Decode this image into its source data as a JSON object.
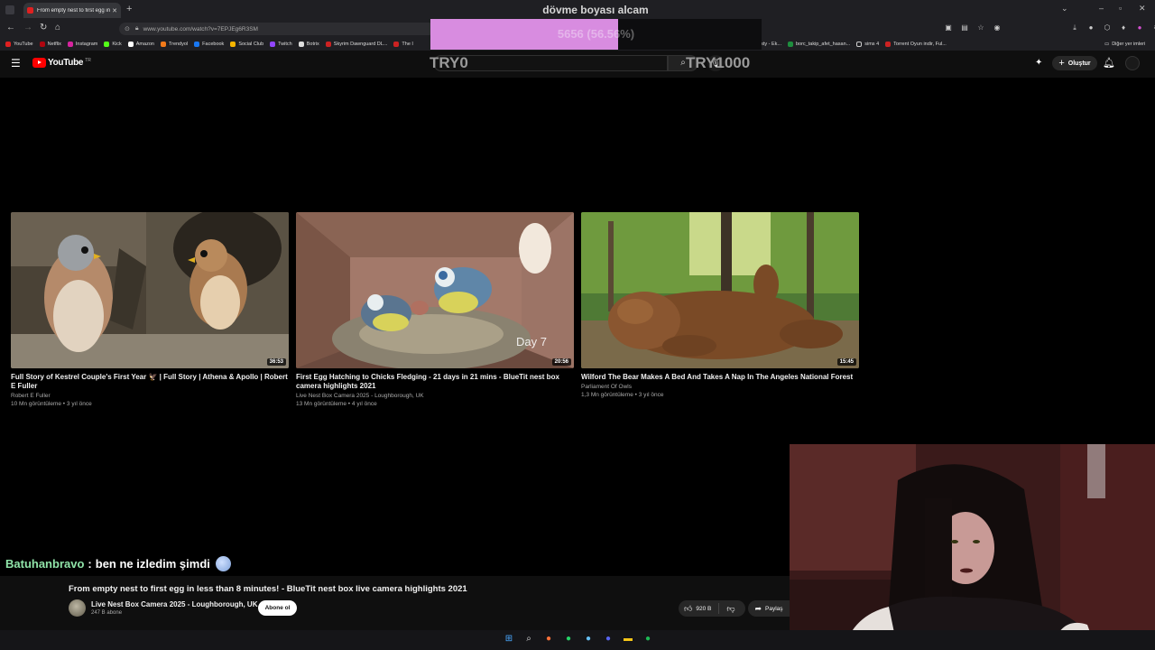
{
  "browser": {
    "tab_title": "From empty nest to first egg in",
    "url": "www.youtube.com/watch?v=7EPJEg6R3SM",
    "bookmarks": [
      "YouTube",
      "Netflix",
      "Instagram",
      "Kick",
      "Amazon",
      "Trendyol",
      "Facebook",
      "Social Club",
      "Twitch",
      "Botrix",
      "Skyrim Dawnguard DL...",
      "The I"
    ],
    "bookmarks_right": [
      "asty - Ek...",
      "borc_takip_afet_hasan...",
      "sims 4",
      "Torrent Oyun indir, Ful..."
    ],
    "other_bookmarks": "Diğer yer imleri"
  },
  "overlay": {
    "title": "dövme boyası alcam",
    "goal_text": "5656 (56.56%)",
    "goal_progress": 0.5656,
    "goal_min": "TRY0",
    "goal_max": "TRY1000",
    "colors": {
      "fill": "#d88ce0"
    }
  },
  "youtube": {
    "logo": "YouTube",
    "logo_region": "TR",
    "create_label": "Oluştur",
    "icons": [
      "menu-icon",
      "search-icon",
      "mic-icon",
      "cast-icon",
      "bell-icon"
    ]
  },
  "videos": [
    {
      "title": "Full Story of Kestrel Couple's First Year 🦅 | Full Story | Athena & Apollo | Robert E Fuller",
      "channel": "Robert E Fuller",
      "meta": "10 Mn görüntüleme • 3 yıl önce",
      "duration": "36:53"
    },
    {
      "title": "First Egg Hatching to Chicks Fledging - 21 days in 21 mins - BlueTit nest box camera highlights 2021",
      "channel": "Live Nest Box Camera 2025 - Loughborough, UK",
      "meta": "13 Mn görüntüleme • 4 yıl önce",
      "duration": "20:56",
      "overlay_text": "Day 7"
    },
    {
      "title": "Wilford The Bear Makes A Bed And Takes A Nap In The Angeles National Forest",
      "channel": "Parliament Of Owls",
      "meta": "1,3 Mn görüntüleme • 3 yıl önce",
      "duration": "15:45"
    }
  ],
  "chat": {
    "user": "Batuhanbravo",
    "separator": ":",
    "message": "ben ne izledim şimdi"
  },
  "player": {
    "title": "From empty nest to first egg in less than 8 minutes! - BlueTit nest box live camera highlights 2021",
    "channel": "Live Nest Box Camera 2025 - Loughborough, UK",
    "subscribers": "247 B abone",
    "subscribe_label": "Abone ol",
    "likes": "920 B",
    "share_label": "Paylaş"
  }
}
